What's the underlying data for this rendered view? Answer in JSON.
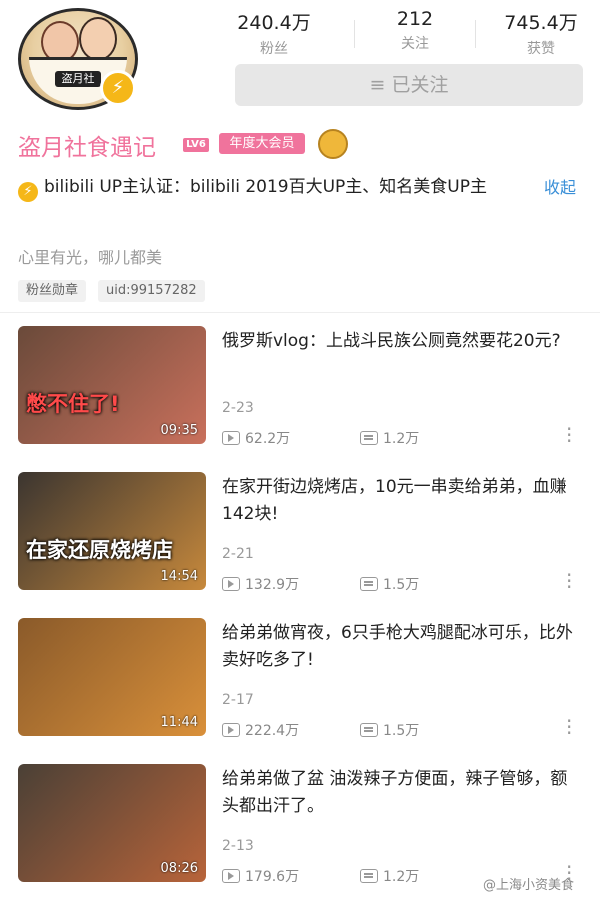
{
  "stats": [
    {
      "value": "240.4万",
      "label": "粉丝"
    },
    {
      "value": "212",
      "label": "关注"
    },
    {
      "value": "745.4万",
      "label": "获赞"
    }
  ],
  "follow_button": "≡ 已关注",
  "avatar_tag": "盗月社",
  "channel_name": "盗月社食遇记",
  "level_badge": "LV6",
  "vip_badge": "年度大会员",
  "verification": "bilibili  UP主认证：bilibili  2019百大UP主、知名美食UP主",
  "collapse_link": "收起",
  "signature": "心里有光，哪儿都美",
  "chips": [
    "粉丝勋章",
    "uid:99157282"
  ],
  "videos": [
    {
      "title": "俄罗斯vlog：上战斗民族公厕竟然要花20元?",
      "date": "2-23",
      "views": "62.2万",
      "danmaku": "1.2万",
      "duration": "09:35",
      "caption": "憋不住了!",
      "thumb_colors": [
        "#6a4a3a",
        "#c9705c"
      ]
    },
    {
      "title": "在家开街边烧烤店，10元一串卖给弟弟，血赚142块!",
      "date": "2-21",
      "views": "132.9万",
      "danmaku": "1.5万",
      "duration": "14:54",
      "caption": "在家还原烧烤店",
      "thumb_colors": [
        "#3b3530",
        "#c7893c"
      ]
    },
    {
      "title": "给弟弟做宵夜，6只手枪大鸡腿配冰可乐，比外卖好吃多了!",
      "date": "2-17",
      "views": "222.4万",
      "danmaku": "1.5万",
      "duration": "11:44",
      "caption": "",
      "thumb_colors": [
        "#8a5a2a",
        "#d9903a"
      ]
    },
    {
      "title": "给弟弟做了盆 油泼辣子方便面，辣子管够，额头都出汗了。",
      "date": "2-13",
      "views": "179.6万",
      "danmaku": "1.2万",
      "duration": "08:26",
      "caption": "",
      "thumb_colors": [
        "#4a4036",
        "#b8643a"
      ]
    }
  ],
  "watermark": "@上海小资美食",
  "colors": {
    "accent_pink": "#f0739c",
    "link_blue": "#3a8fd7",
    "verify_yellow": "#f5b718"
  }
}
